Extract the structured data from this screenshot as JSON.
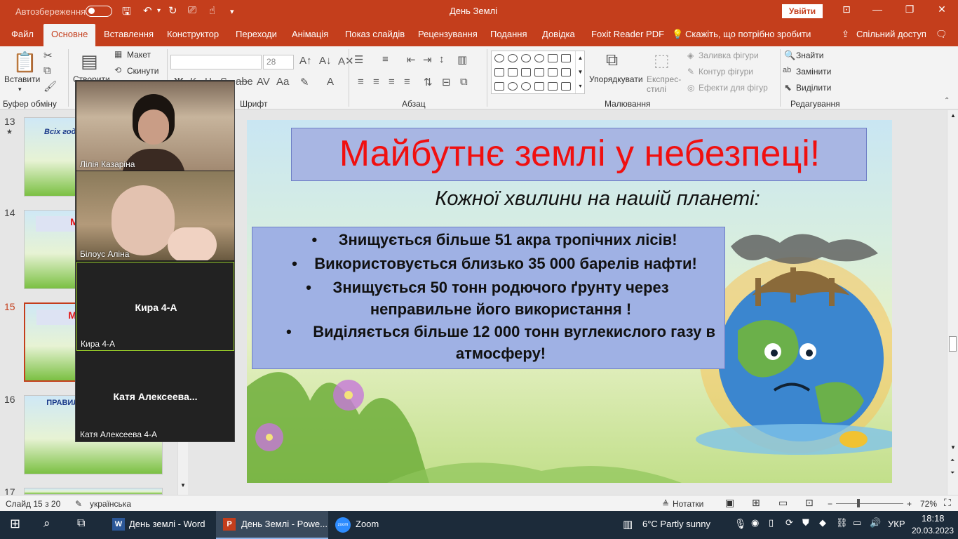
{
  "titlebar": {
    "autosave_label": "Автозбереження",
    "doc_title": "День Землі",
    "login_label": "Увійти"
  },
  "tabs": [
    "Файл",
    "Основне",
    "Вставлення",
    "Конструктор",
    "Переходи",
    "Анімація",
    "Показ слайдів",
    "Рецензування",
    "Подання",
    "Довідка",
    "Foxit Reader PDF"
  ],
  "tell_me": "Скажіть, що потрібно зробити",
  "share_label": "Спільний доступ",
  "ribbon": {
    "paste_label": "Вставити",
    "create_label": "Створити",
    "layout_label": "Макет",
    "reset_label": "Скинути",
    "font_size": "28",
    "arrange_label": "Упорядкувати",
    "express_styles_label": "Експрес-стилі",
    "shape_fill_label": "Заливка фігури",
    "shape_outline_label": "Контур фігури",
    "shape_effects_label": "Ефекти для фігур",
    "find_label": "Знайти",
    "replace_label": "Замінити",
    "select_label": "Виділити",
    "groups": {
      "clipboard": "Буфер обміну",
      "font": "Шрифт",
      "paragraph": "Абзац",
      "drawing": "Малювання",
      "editing": "Редагування"
    }
  },
  "thumbnails": [
    {
      "num": "13",
      "title": "Всіх году... а про неї н..."
    },
    {
      "num": "14",
      "title": "Майбутн..."
    },
    {
      "num": "15",
      "title": "Майбутнє...",
      "selected": true
    },
    {
      "num": "16",
      "title": "ПРАВИЛА ПО... В ПРИР..."
    },
    {
      "num": "17",
      "title": ""
    }
  ],
  "zoom_participants": [
    {
      "name": "Лілія Казаріна",
      "video": true
    },
    {
      "name": "Білоус Аліна",
      "video": true
    },
    {
      "name": "Кира 4-А",
      "display": "Кира 4-А",
      "video": false
    },
    {
      "name": "Катя Алексеева 4-А",
      "display": "Катя  Алексеева...",
      "video": false
    }
  ],
  "slide": {
    "title": "Майбутнє землі у небезпеці!",
    "subtitle": "Кожної хвилини на нашій планеті:",
    "bullets": [
      "Знищується більше 51 акра тропічних лісів!",
      "Використовується близько 35 000 барелів нафти!",
      "Знищується 50 тонн родючого ґрунту через",
      "неправильне його використання !",
      "Виділяється більше 12 000 тонн вуглекислого газу в",
      "атмосферу!"
    ]
  },
  "status": {
    "slide_counter": "Слайд 15 з 20",
    "language": "українська",
    "notes_label": "Нотатки",
    "zoom_level": "72%"
  },
  "taskbar": {
    "apps": [
      {
        "label": "День землі - Word"
      },
      {
        "label": "День Землі - Powe..."
      },
      {
        "label": "Zoom"
      }
    ],
    "weather": "6°C  Partly sunny",
    "lang": "УКР",
    "time": "18:18",
    "date": "20.03.2023"
  }
}
